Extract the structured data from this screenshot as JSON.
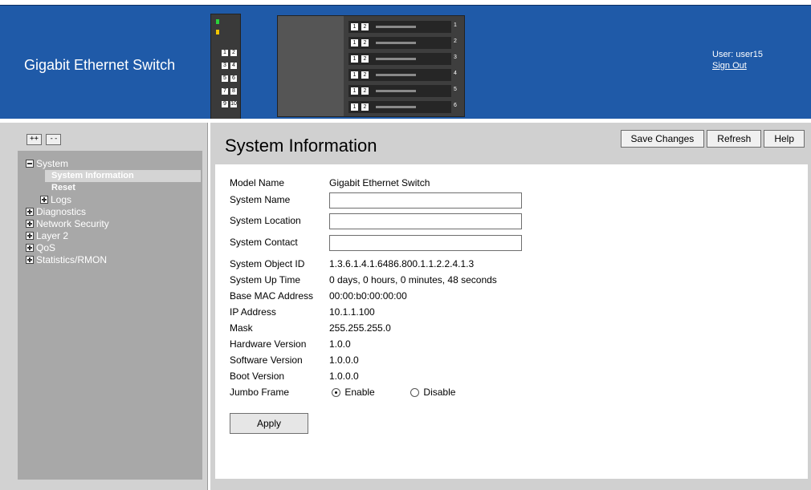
{
  "header": {
    "brand": "Gigabit Ethernet Switch",
    "user": "User: user15",
    "sign_out": "Sign Out"
  },
  "sidebar": {
    "expand_all": "++",
    "collapse_all": "--",
    "tree": [
      {
        "label": "System",
        "expanded": true
      },
      {
        "label": "System Information"
      },
      {
        "label": "Reset"
      },
      {
        "label": "Logs",
        "expanded": false
      },
      {
        "label": "Diagnostics",
        "expanded": false
      },
      {
        "label": "Network Security",
        "expanded": false
      },
      {
        "label": "Layer 2",
        "expanded": false
      },
      {
        "label": "QoS",
        "expanded": false
      },
      {
        "label": "Statistics/RMON",
        "expanded": false
      }
    ]
  },
  "main": {
    "title": "System Information",
    "buttons": {
      "save": "Save Changes",
      "refresh": "Refresh",
      "help": "Help"
    },
    "fields": {
      "model_name": {
        "label": "Model Name",
        "value": "Gigabit Ethernet Switch"
      },
      "system_name": {
        "label": "System Name",
        "value": ""
      },
      "system_location": {
        "label": "System Location",
        "value": ""
      },
      "system_contact": {
        "label": "System Contact",
        "value": ""
      },
      "object_id": {
        "label": "System Object ID",
        "value": "1.3.6.1.4.1.6486.800.1.1.2.2.4.1.3"
      },
      "uptime": {
        "label": "System Up Time",
        "value": "0 days, 0 hours, 0 minutes, 48 seconds"
      },
      "mac": {
        "label": "Base MAC Address",
        "value": "00:00:b0:00:00:00"
      },
      "ip": {
        "label": "IP Address",
        "value": "10.1.1.100"
      },
      "mask": {
        "label": "Mask",
        "value": "255.255.255.0"
      },
      "hw": {
        "label": "Hardware Version",
        "value": "1.0.0"
      },
      "sw": {
        "label": "Software Version",
        "value": "1.0.0.0"
      },
      "boot": {
        "label": "Boot Version",
        "value": "1.0.0.0"
      },
      "jumbo": {
        "label": "Jumbo Frame",
        "enable": "Enable",
        "disable": "Disable",
        "selected": "Enable"
      }
    },
    "apply": "Apply"
  },
  "switch_ports": [
    "1",
    "2",
    "3",
    "4",
    "5",
    "6",
    "7",
    "8",
    "9",
    "10"
  ],
  "chassis_slots": [
    "1",
    "2",
    "3",
    "4",
    "5",
    "6"
  ],
  "colors": {
    "banner": "#1f5aa8",
    "sidebar_bg": "#d2d2d2",
    "panel_bg": "#a8a8a8",
    "main_bg": "#d0d0d0"
  }
}
